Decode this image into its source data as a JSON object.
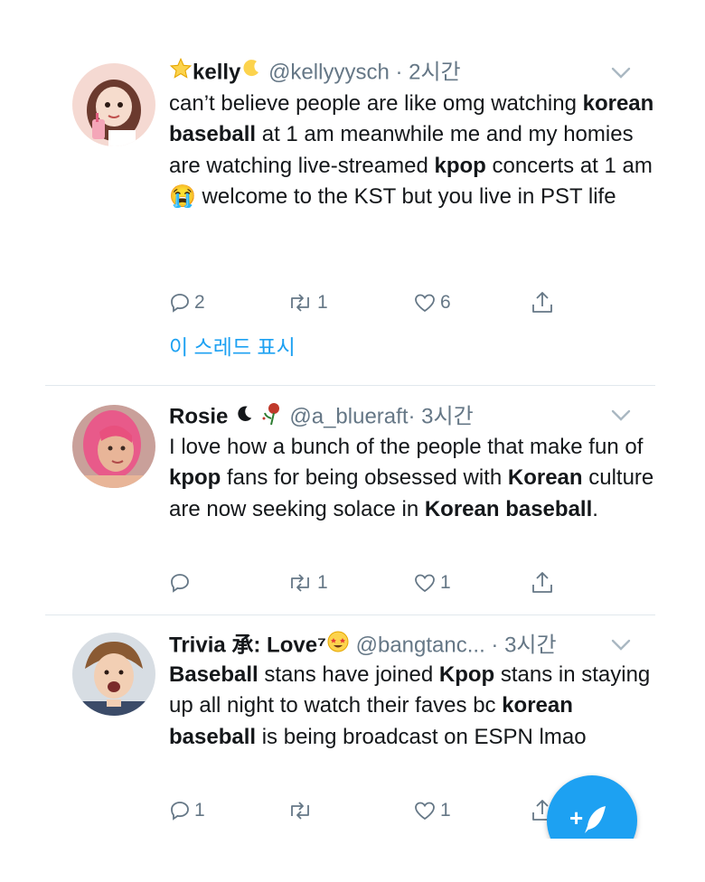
{
  "tweets": [
    {
      "name": "kelly",
      "handle": "@kellyyysch",
      "time": "· 2시간",
      "text_segments": [
        {
          "t": "can’t believe people are like omg watching ",
          "b": false
        },
        {
          "t": "korean baseball",
          "b": true
        },
        {
          "t": " at 1 am meanwhile me and my homies are watching live-streamed ",
          "b": false
        },
        {
          "t": "kpop",
          "b": true
        },
        {
          "t": " concerts at 1 am ",
          "b": false
        },
        {
          "t": "😭",
          "b": false
        },
        {
          "t": " welcome to the KST but you live in PST life",
          "b": false
        }
      ],
      "replies": "2",
      "retweets": "1",
      "likes": "6",
      "show_thread": "이 스레드 표시"
    },
    {
      "name": "Rosie",
      "handle": "@a_blueraft",
      "time": "· 3시간",
      "text_segments": [
        {
          "t": "I love how a bunch of the people that make fun of ",
          "b": false
        },
        {
          "t": "kpop",
          "b": true
        },
        {
          "t": " fans for being obsessed with ",
          "b": false
        },
        {
          "t": "Korean",
          "b": true
        },
        {
          "t": " culture are now seeking solace in ",
          "b": false
        },
        {
          "t": "Korean baseball",
          "b": true
        },
        {
          "t": ".",
          "b": false
        }
      ],
      "replies": "",
      "retweets": "1",
      "likes": "1"
    },
    {
      "name": "Trivia 承: Love⁷",
      "handle": "@bangtanc...",
      "time": "· 3시간",
      "text_segments": [
        {
          "t": "Baseball",
          "b": true
        },
        {
          "t": " stans have joined ",
          "b": false
        },
        {
          "t": "Kpop",
          "b": true
        },
        {
          "t": " stans in staying up all night to watch their faves bc ",
          "b": false
        },
        {
          "t": "korean baseball",
          "b": true
        },
        {
          "t": " is being broadcast on ESPN lmao",
          "b": false
        }
      ],
      "replies": "1",
      "retweets": "",
      "likes": "1"
    }
  ],
  "compose_button": "+✎",
  "colors": {
    "accent": "#1da1f2",
    "secondary_text": "#657786",
    "primary_text": "#14171a",
    "divider": "#e1e8ed"
  },
  "icons": [
    "reply-icon",
    "retweet-icon",
    "like-icon",
    "share-icon",
    "chevron-down-icon",
    "compose-feather-icon"
  ]
}
